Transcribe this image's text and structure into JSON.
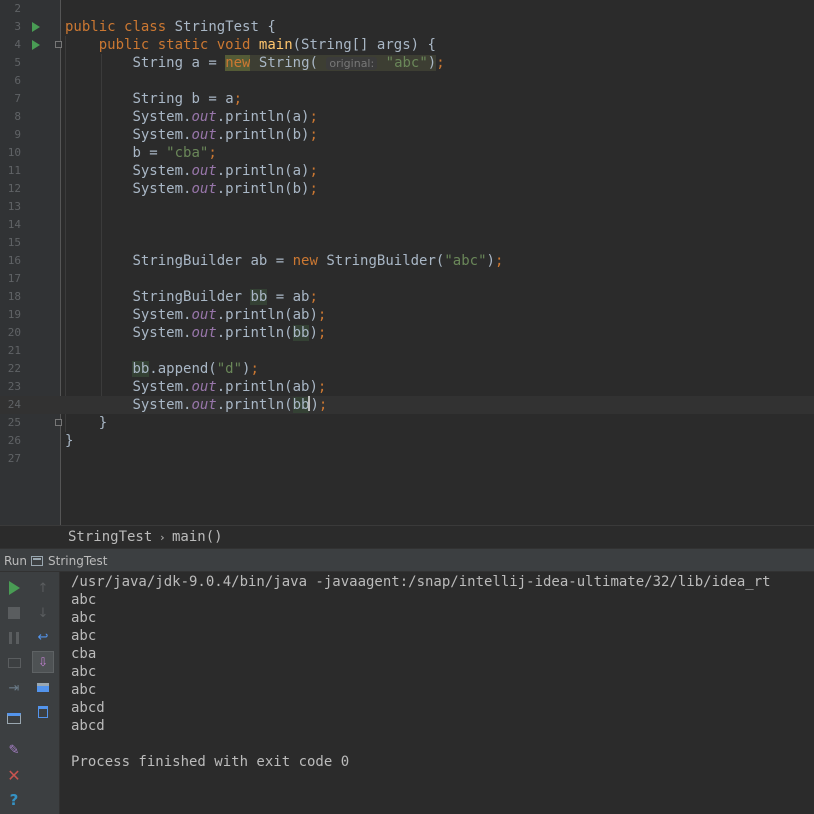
{
  "editor": {
    "lines": [
      {
        "num": "2"
      },
      {
        "num": "3"
      },
      {
        "num": "4"
      },
      {
        "num": "5"
      },
      {
        "num": "6"
      },
      {
        "num": "7"
      },
      {
        "num": "8"
      },
      {
        "num": "9"
      },
      {
        "num": "10"
      },
      {
        "num": "11"
      },
      {
        "num": "12"
      },
      {
        "num": "13"
      },
      {
        "num": "14"
      },
      {
        "num": "15"
      },
      {
        "num": "16"
      },
      {
        "num": "17"
      },
      {
        "num": "18"
      },
      {
        "num": "19"
      },
      {
        "num": "20"
      },
      {
        "num": "21"
      },
      {
        "num": "22"
      },
      {
        "num": "23"
      },
      {
        "num": "24"
      },
      {
        "num": "25"
      },
      {
        "num": "26"
      },
      {
        "num": "27"
      }
    ],
    "t": {
      "public": "public",
      "class": "class",
      "static": "static",
      "void": "void",
      "new": "new",
      "className": "StringTest",
      "main": "main",
      "mainArgs": "(String[] args) {",
      "braceOpen": " {",
      "braceClose": "}",
      "stringType": "String",
      "sbType": "StringBuilder",
      "system": "System.",
      "out": "out",
      "println": ".println(",
      "a": "a",
      "b": "b",
      "ab": "ab",
      "bb": "bb",
      "eq": " = ",
      "semicolon": ";",
      "closeParen": ")",
      "hint": "original:",
      "strAbc": "\"abc\"",
      "strCba": "\"cba\"",
      "strD": "\"d\"",
      "append": ".append(",
      "stringCtor": "String(",
      "sbCtor": "StringBuilder("
    }
  },
  "breadcrumb": {
    "class": "StringTest",
    "method": "main()"
  },
  "run": {
    "label": "Run",
    "title": "StringTest"
  },
  "console": {
    "lines": [
      "/usr/java/jdk-9.0.4/bin/java -javaagent:/snap/intellij-idea-ultimate/32/lib/idea_rt",
      "abc",
      "abc",
      "abc",
      "cba",
      "abc",
      "abc",
      "abcd",
      "abcd",
      "",
      "Process finished with exit code 0"
    ]
  },
  "icons": {
    "rerun": "play-icon",
    "stop": "stop-icon",
    "pause": "pause-icon",
    "dump": "camera-icon",
    "exit": "exit-icon",
    "layout": "layout-icon",
    "pin": "pin-icon",
    "close": "close-icon",
    "help": "help-icon",
    "up": "arrow-up-icon",
    "down": "arrow-down-icon",
    "wrap": "soft-wrap-icon",
    "scroll": "scroll-to-end-icon",
    "print": "print-icon",
    "clear": "trash-icon"
  },
  "colors": {
    "keyword": "#cc7832",
    "string": "#6a8759",
    "field": "#9876aa",
    "method": "#ffc66d",
    "text": "#a9b7c6",
    "runGreen": "#499c54",
    "closeRed": "#c75450",
    "helpBlue": "#3592c4"
  }
}
